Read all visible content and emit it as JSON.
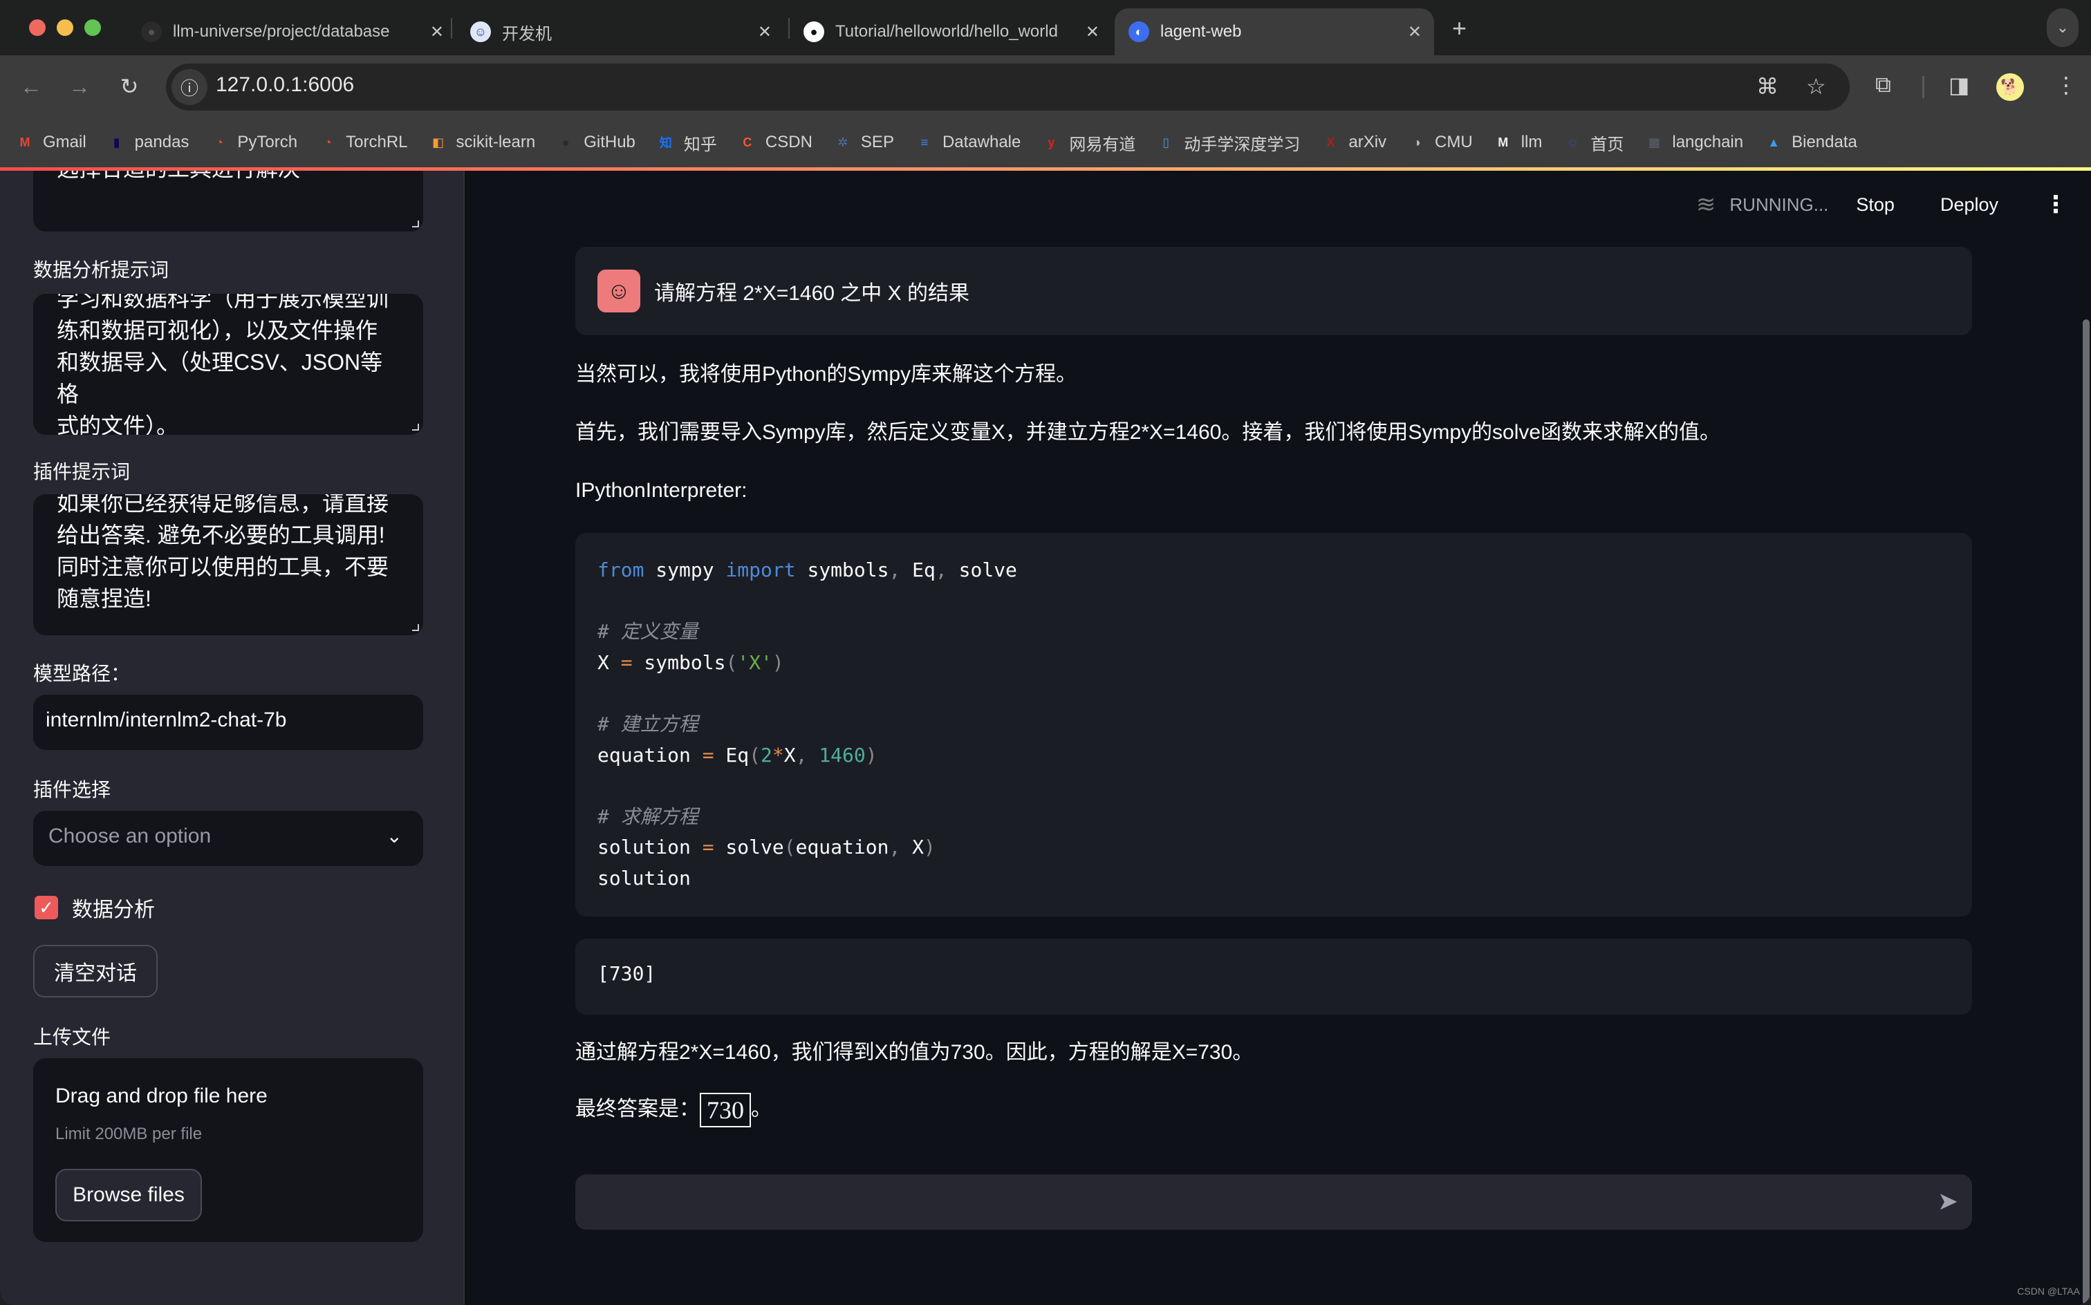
{
  "browser": {
    "tabs": [
      {
        "title": "llm-universe/project/database",
        "icon": "github-icon",
        "active": false
      },
      {
        "title": "开发机",
        "icon": "internlm-icon",
        "active": false
      },
      {
        "title": "Tutorial/helloworld/hello_world",
        "icon": "github-icon",
        "active": false
      },
      {
        "title": "lagent-web",
        "icon": "streamlit-icon",
        "active": true
      }
    ],
    "close_glyph": "✕",
    "new_tab_glyph": "+",
    "tab_search_glyph": "⌄",
    "url": "127.0.0.1:6006",
    "bookmarks": [
      {
        "label": "Gmail",
        "icon": "gmail-icon",
        "glyph": "M",
        "color": "#ea4335"
      },
      {
        "label": "pandas",
        "icon": "pandas-icon",
        "glyph": "▮",
        "color": "#150458"
      },
      {
        "label": "PyTorch",
        "icon": "pytorch-icon",
        "glyph": "◔",
        "color": "#ee4c2c"
      },
      {
        "label": "TorchRL",
        "icon": "torchrl-icon",
        "glyph": "◔",
        "color": "#ee4c2c"
      },
      {
        "label": "scikit-learn",
        "icon": "scikit-learn-icon",
        "glyph": "◧",
        "color": "#f89939"
      },
      {
        "label": "GitHub",
        "icon": "github-icon",
        "glyph": "●",
        "color": "#2b2b2b"
      },
      {
        "label": "知乎",
        "icon": "zhihu-icon",
        "glyph": "知",
        "color": "#1772f6"
      },
      {
        "label": "CSDN",
        "icon": "csdn-icon",
        "glyph": "C",
        "color": "#fc5531"
      },
      {
        "label": "SEP",
        "icon": "sep-icon",
        "glyph": "✲",
        "color": "#4a6fa5"
      },
      {
        "label": "Datawhale",
        "icon": "datawhale-icon",
        "glyph": "≡",
        "color": "#4285f4"
      },
      {
        "label": "网易有道",
        "icon": "youdao-icon",
        "glyph": "y",
        "color": "#e02020"
      },
      {
        "label": "动手学深度学习",
        "icon": "d2l-icon",
        "glyph": "▯",
        "color": "#3d9be9"
      },
      {
        "label": "arXiv",
        "icon": "arxiv-icon",
        "glyph": "X",
        "color": "#b31b1b"
      },
      {
        "label": "CMU",
        "icon": "cmu-icon",
        "glyph": "◑",
        "color": "#bbbbbb"
      },
      {
        "label": "llm",
        "icon": "markdown-doc-icon",
        "glyph": "M",
        "color": "#eeeeee"
      },
      {
        "label": "首页",
        "icon": "internlm-icon",
        "glyph": "☺",
        "color": "#2c4f9e"
      },
      {
        "label": "langchain",
        "icon": "langchain-icon",
        "glyph": "▦",
        "color": "#5a6270"
      },
      {
        "label": "Biendata",
        "icon": "biendata-icon",
        "glyph": "▲",
        "color": "#3d9be9"
      }
    ]
  },
  "sidebar": {
    "top_textarea_partial": "选择合适的工具进行解决",
    "data_prompt_label": "数据分析提示词",
    "data_prompt_value": "学习和数据科学（用于展示模型训练和数据可视化），以及文件操作和数据导入（处理CSV、JSON等格式的文件）。",
    "data_prompt_lines": [
      "学习和数据科学（用于展示模型训",
      "练和数据可视化），以及文件操作",
      "和数据导入（处理CSV、JSON等格",
      "式的文件）。"
    ],
    "plugin_prompt_label": "插件提示词",
    "plugin_prompt_lines": [
      "如果你已经获得足够信息，请直接",
      "给出答案. 避免不必要的工具调用!",
      "同时注意你可以使用的工具，不要",
      "随意捏造!"
    ],
    "model_path_label": "模型路径：",
    "model_path_value": "internlm/internlm2-chat-7b",
    "plugin_select_label": "插件选择",
    "plugin_select_placeholder": "Choose an option",
    "data_analysis_checkbox": {
      "label": "数据分析",
      "checked": true
    },
    "clear_button": "清空对话",
    "upload_label": "上传文件",
    "dropzone_title": "Drag and drop file here",
    "dropzone_limit": "Limit 200MB per file",
    "browse_button": "Browse files"
  },
  "header": {
    "status": "RUNNING...",
    "stop": "Stop",
    "deploy": "Deploy"
  },
  "chat": {
    "user_message": "请解方程 2*X=1460 之中 X 的结果",
    "assistant": {
      "p1": "当然可以，我将使用Python的Sympy库来解这个方程。",
      "p2": "首先，我们需要导入Sympy库，然后定义变量X，并建立方程2*X=1460。接着，我们将使用Sympy的solve函数来求解X的值。",
      "tool_name": "IPythonInterpreter:",
      "code_lines": [
        "from sympy import symbols, Eq, solve",
        "",
        "# 定义变量",
        "X = symbols('X')",
        "",
        "# 建立方程",
        "equation = Eq(2*X, 1460)",
        "",
        "# 求解方程",
        "solution = solve(equation, X)",
        "solution"
      ],
      "output": "[730]",
      "p3": "通过解方程2*X=1460，我们得到X的值为730。因此，方程的解是X=730。",
      "final_prefix": "最终答案是：",
      "final_answer": "730",
      "final_suffix": "。"
    },
    "input_placeholder": ""
  },
  "watermark": "CSDN @LTAA"
}
